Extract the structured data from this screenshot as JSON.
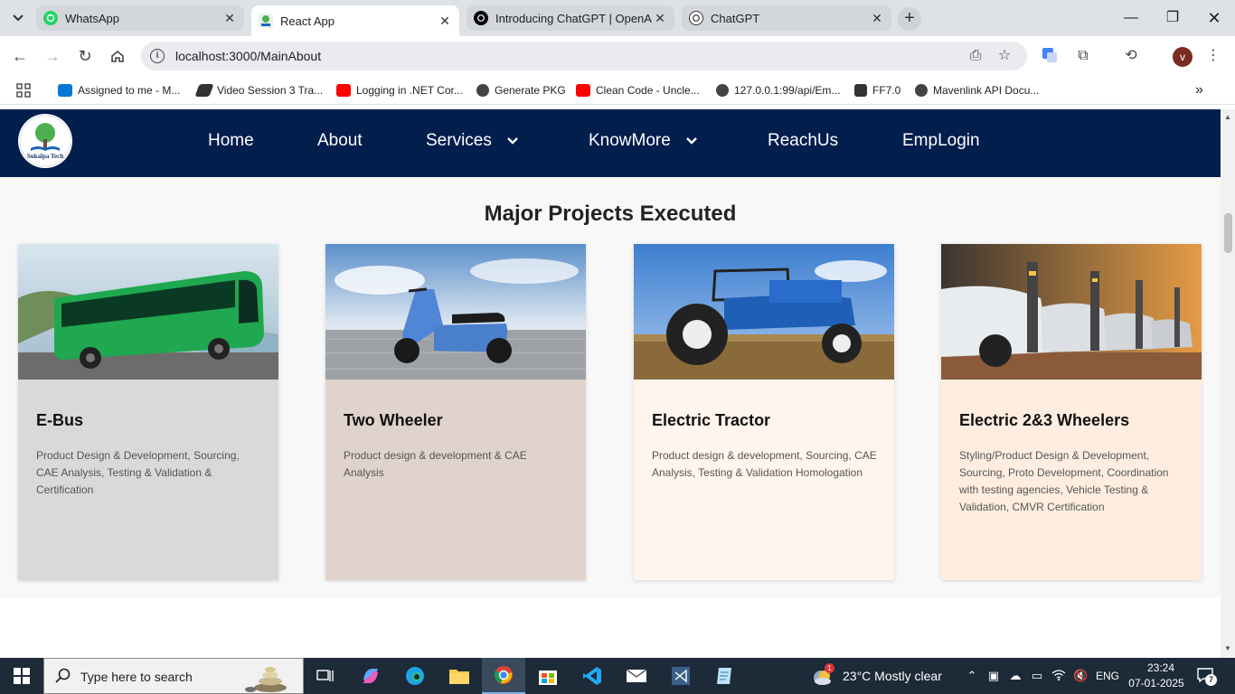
{
  "browser": {
    "tabs": [
      {
        "title": "WhatsApp",
        "icon": "whatsapp-icon"
      },
      {
        "title": "React App",
        "icon": "react-app-favicon"
      },
      {
        "title": "Introducing ChatGPT | OpenAI",
        "icon": "openai-icon"
      },
      {
        "title": "ChatGPT",
        "icon": "openai-icon"
      }
    ],
    "new_tab_label": "+",
    "url": "localhost:3000/MainAbout",
    "profile_initial": "v",
    "bookmarks": [
      {
        "label": "Assigned to me - M...",
        "icon": "azure-devops-icon"
      },
      {
        "label": "Video Session 3 Tra...",
        "icon": "video-icon"
      },
      {
        "label": "Logging in .NET Cor...",
        "icon": "youtube-icon"
      },
      {
        "label": "Generate PKG",
        "icon": "globe-icon"
      },
      {
        "label": "Clean Code - Uncle...",
        "icon": "youtube-icon"
      },
      {
        "label": "127.0.0.1:99/api/Em...",
        "icon": "globe-icon"
      },
      {
        "label": "FF7.0",
        "icon": "folder-icon"
      },
      {
        "label": "Mavenlink API Docu...",
        "icon": "globe-icon"
      }
    ]
  },
  "site": {
    "logo_text": "Sukalpa Tech",
    "nav": [
      {
        "label": "Home",
        "dropdown": false
      },
      {
        "label": "About",
        "dropdown": false
      },
      {
        "label": "Services",
        "dropdown": true
      },
      {
        "label": "KnowMore",
        "dropdown": true
      },
      {
        "label": "ReachUs",
        "dropdown": false
      },
      {
        "label": "EmpLogin",
        "dropdown": false
      }
    ],
    "section_title": "Major Projects Executed",
    "cards": [
      {
        "title": "E-Bus",
        "description": "Product Design & Development, Sourcing, CAE Analysis, Testing & Validation & Certification",
        "bg": "#d9d9d9",
        "image": "green-electric-bus-image"
      },
      {
        "title": "Two Wheeler",
        "description": "Product design & development & CAE Analysis",
        "bg": "#e0d3cb",
        "image": "blue-scooter-image"
      },
      {
        "title": "Electric Tractor",
        "description": "Product design & development, Sourcing, CAE Analysis, Testing & Validation Homologation",
        "bg": "#fff5ec",
        "image": "blue-tractor-image"
      },
      {
        "title": "Electric 2&3 Wheelers",
        "description": "Styling/Product Design & Development, Sourcing, Proto Development, Coordination with testing agencies, Vehicle Testing & Validation, CMVR Certification",
        "bg": "#ffeee0",
        "image": "ev-charging-cars-image"
      }
    ]
  },
  "taskbar": {
    "search_placeholder": "Type here to search",
    "weather": "23°C  Mostly clear",
    "weather_badge": "1",
    "language": "ENG",
    "time": "23:24",
    "date": "07-01-2025",
    "notification_count": "7"
  },
  "colors": {
    "nav_bg": "#011e4d",
    "taskbar_bg": "#1d2a38"
  }
}
